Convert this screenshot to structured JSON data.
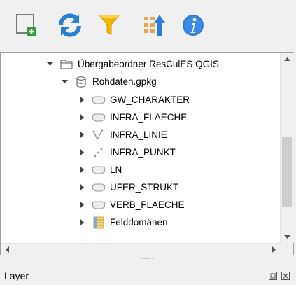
{
  "toolbar": {
    "buttons": [
      {
        "icon": "new-layer-icon"
      },
      {
        "icon": "refresh-icon"
      },
      {
        "icon": "filter-icon"
      },
      {
        "icon": "collapse-icon"
      },
      {
        "icon": "info-icon"
      }
    ]
  },
  "tree": {
    "items": [
      {
        "label": "Übergabeordner ResCulES QGIS",
        "icon": "folder-icon",
        "expanded": true,
        "level": 0
      },
      {
        "label": "Rohdaten.gpkg",
        "icon": "database-icon",
        "expanded": true,
        "level": 1
      },
      {
        "label": "GW_CHARAKTER",
        "icon": "polygon-layer-icon",
        "expanded": false,
        "level": 2
      },
      {
        "label": "INFRA_FLAECHE",
        "icon": "polygon-layer-icon",
        "expanded": false,
        "level": 2
      },
      {
        "label": "INFRA_LINIE",
        "icon": "line-layer-icon",
        "expanded": false,
        "level": 2
      },
      {
        "label": "INFRA_PUNKT",
        "icon": "point-layer-icon",
        "expanded": false,
        "level": 2
      },
      {
        "label": "LN",
        "icon": "polygon-layer-icon",
        "expanded": false,
        "level": 2
      },
      {
        "label": "UFER_STRUKT",
        "icon": "polygon-layer-icon",
        "expanded": false,
        "level": 2
      },
      {
        "label": "VERB_FLAECHE",
        "icon": "polygon-layer-icon",
        "expanded": false,
        "level": 2
      },
      {
        "label": "Felddomänen",
        "icon": "table-icon",
        "expanded": false,
        "level": 2
      }
    ]
  },
  "panel": {
    "title": "Layer"
  },
  "colors": {
    "accent_blue": "#2a7fd4",
    "filter_yellow": "#f5b800",
    "info_blue": "#2f7ad8",
    "new_green": "#2e9e38"
  }
}
